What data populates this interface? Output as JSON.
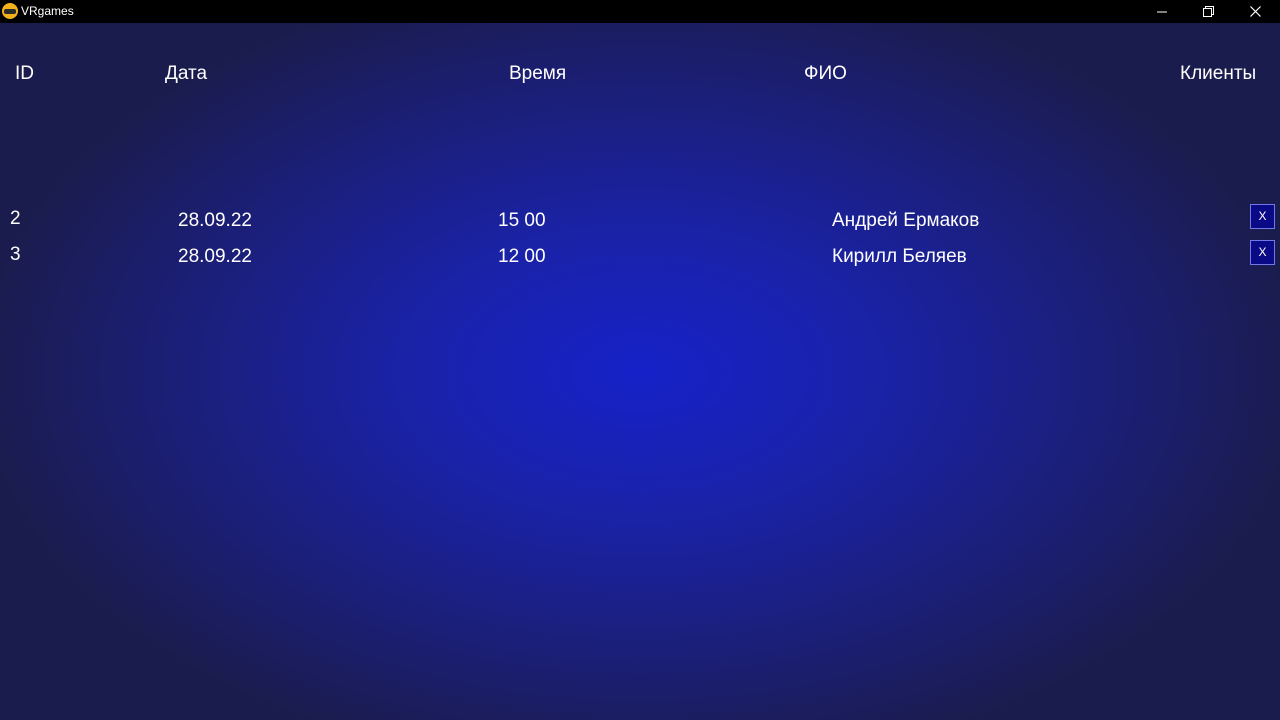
{
  "window": {
    "title": "VRgames",
    "icon": "vr-headset-icon",
    "controls": [
      "minimize-icon",
      "restore-icon",
      "close-icon"
    ]
  },
  "table": {
    "headers": {
      "id": "ID",
      "date": "Дата",
      "time": "Время",
      "name": "ФИО",
      "clients": "Клиенты"
    },
    "rows": [
      {
        "id": "2",
        "date": "28.09.22",
        "time": "15 00",
        "name": "Андрей Ермаков",
        "delete_label": "X"
      },
      {
        "id": "3",
        "date": "28.09.22",
        "time": "12 00",
        "name": "Кирилл Беляев",
        "delete_label": "X"
      }
    ]
  },
  "colors": {
    "titlebar": "#000000",
    "background_edge": "#1b1c4e",
    "background_center": "#1622c8",
    "delete_button_fill": "#0a0a86",
    "delete_button_border": "#6f78e6",
    "text": "#ffffff"
  }
}
